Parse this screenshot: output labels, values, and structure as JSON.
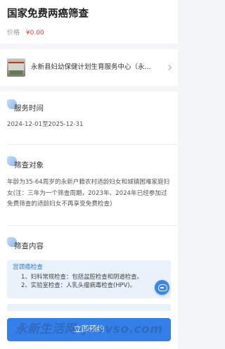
{
  "header": {
    "title": "国家免费两癌筛查",
    "price_label": "价格",
    "price_value": "¥0.00"
  },
  "org": {
    "name": "永新县妇幼保健计划生育服务中心（永...",
    "thumbnail_icon": "hospital-photo"
  },
  "sections": {
    "service_time": {
      "title": "服务时间",
      "text": "2024-12-01至2025-12-31"
    },
    "target": {
      "title": "筛查对象",
      "text": "年龄为35-64周岁的永新户籍农村适龄妇女和城镇困难家庭妇女(注：三年为一个筛查周期，2023年、2024年已经参加过免费筛查的适龄妇女不再享受免费检查)"
    },
    "content": {
      "title": "筛查内容",
      "box_title": "宫颈癌检查",
      "items": [
        "1、妇科常规检查：包括盆腔检查和阴道检查。",
        "2、实验室检查：人乳头瘤病毒检查(HPV)。"
      ]
    }
  },
  "cta": {
    "label": "立即预约"
  },
  "floating": {
    "icon": "customer-service-icon"
  },
  "watermark": {
    "text": "永新生活网 yxsvso.com"
  },
  "colors": {
    "accent": "#3480ea",
    "price": "#e23b30",
    "info_box_bg": "#e9f1fb",
    "info_title": "#2f7be3"
  }
}
